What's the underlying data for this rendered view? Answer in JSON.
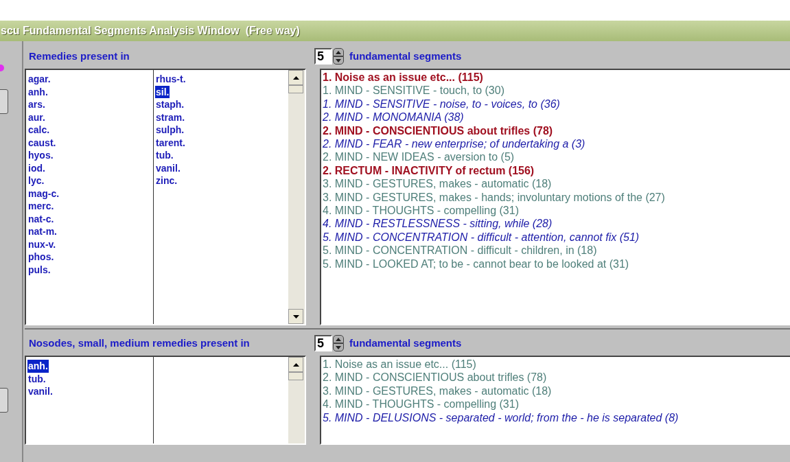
{
  "window": {
    "title": "scu Fundamental Segments Analysis Window  (Free way)"
  },
  "sections": [
    {
      "label_before": "Remedies present in",
      "count": "5",
      "label_after": "fundamental segments",
      "remedy_columns": [
        [
          {
            "name": "agar.",
            "selected": false
          },
          {
            "name": "anh.",
            "selected": false
          },
          {
            "name": "ars.",
            "selected": false
          },
          {
            "name": "aur.",
            "selected": false
          },
          {
            "name": "calc.",
            "selected": false
          },
          {
            "name": "caust.",
            "selected": false
          },
          {
            "name": "hyos.",
            "selected": false
          },
          {
            "name": "iod.",
            "selected": false
          },
          {
            "name": "lyc.",
            "selected": false
          },
          {
            "name": "mag-c.",
            "selected": false
          },
          {
            "name": "merc.",
            "selected": false
          },
          {
            "name": "nat-c.",
            "selected": false
          },
          {
            "name": "nat-m.",
            "selected": false
          },
          {
            "name": "nux-v.",
            "selected": false
          },
          {
            "name": "phos.",
            "selected": false
          },
          {
            "name": "puls.",
            "selected": false
          }
        ],
        [
          {
            "name": "rhus-t.",
            "selected": false
          },
          {
            "name": "sil.",
            "selected": true
          },
          {
            "name": "staph.",
            "selected": false
          },
          {
            "name": "stram.",
            "selected": false
          },
          {
            "name": "sulph.",
            "selected": false
          },
          {
            "name": "tarent.",
            "selected": false
          },
          {
            "name": "tub.",
            "selected": false
          },
          {
            "name": "vanil.",
            "selected": false
          },
          {
            "name": "zinc.",
            "selected": false
          }
        ]
      ],
      "rubrics": [
        {
          "text": "1. Noise as an issue etc... (115)",
          "kind": "bold"
        },
        {
          "text": "1. MIND - SENSITIVE - touch, to (30)",
          "kind": "plain"
        },
        {
          "text": "1. MIND - SENSITIVE - noise, to - voices, to (36)",
          "kind": "italic"
        },
        {
          "text": "2. MIND - MONOMANIA (38)",
          "kind": "italic"
        },
        {
          "text": "2. MIND - CONSCIENTIOUS about trifles (78)",
          "kind": "bold"
        },
        {
          "text": "2. MIND - FEAR - new enterprise; of undertaking a (3)",
          "kind": "italic"
        },
        {
          "text": "2. MIND - NEW IDEAS - aversion to (5)",
          "kind": "plain"
        },
        {
          "text": "2. RECTUM - INACTIVITY of rectum (156)",
          "kind": "bold"
        },
        {
          "text": "3. MIND - GESTURES, makes - automatic (18)",
          "kind": "plain"
        },
        {
          "text": "3. MIND - GESTURES, makes - hands; involuntary motions of the (27)",
          "kind": "plain"
        },
        {
          "text": "4. MIND - THOUGHTS - compelling (31)",
          "kind": "plain"
        },
        {
          "text": "4. MIND - RESTLESSNESS - sitting, while (28)",
          "kind": "italic"
        },
        {
          "text": "5. MIND - CONCENTRATION - difficult - attention, cannot fix (51)",
          "kind": "italic"
        },
        {
          "text": "5. MIND - CONCENTRATION - difficult - children, in (18)",
          "kind": "plain"
        },
        {
          "text": "5. MIND - LOOKED AT; to be - cannot bear to be looked at (31)",
          "kind": "plain"
        }
      ]
    },
    {
      "label_before": "Nosodes, small, medium remedies present in",
      "count": "5",
      "label_after": "fundamental segments",
      "remedy_columns": [
        [
          {
            "name": "anh.",
            "selected": true
          },
          {
            "name": "tub.",
            "selected": false
          },
          {
            "name": "vanil.",
            "selected": false
          }
        ]
      ],
      "rubrics": [
        {
          "text": "1. Noise as an issue etc... (115)",
          "kind": "plain"
        },
        {
          "text": "2. MIND - CONSCIENTIOUS about trifles (78)",
          "kind": "plain"
        },
        {
          "text": "3. MIND - GESTURES, makes - automatic (18)",
          "kind": "plain"
        },
        {
          "text": "4. MIND - THOUGHTS - compelling (31)",
          "kind": "plain"
        },
        {
          "text": "5. MIND - DELUSIONS - separated - world; from the - he is separated (8)",
          "kind": "italic"
        }
      ]
    }
  ]
}
